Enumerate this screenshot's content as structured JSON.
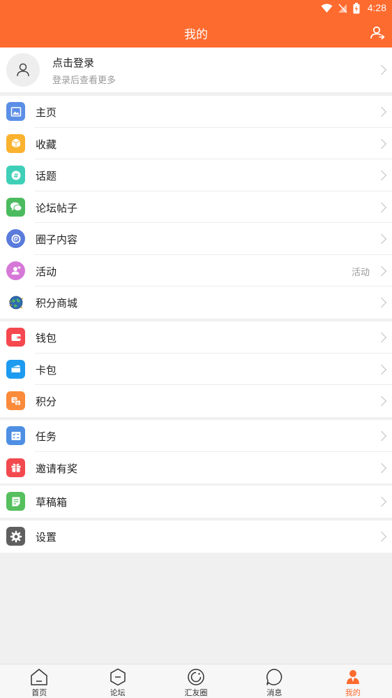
{
  "status_bar": {
    "time": "4:28"
  },
  "header": {
    "title": "我的"
  },
  "login": {
    "title": "点击登录",
    "subtitle": "登录后查看更多"
  },
  "groups": [
    [
      {
        "label": "主页",
        "icon": "image-icon",
        "color": "#5b8ee6"
      },
      {
        "label": "收藏",
        "icon": "box-icon",
        "color": "#fbb22f"
      },
      {
        "label": "话题",
        "icon": "hashtag-icon",
        "color": "#3fcfb8"
      },
      {
        "label": "论坛帖子",
        "icon": "chat-icon",
        "color": "#4cbb5f"
      },
      {
        "label": "圈子内容",
        "icon": "circle-icon",
        "color": "#5a7bdc"
      },
      {
        "label": "活动",
        "icon": "activity-icon",
        "color": "#d678d8",
        "value": "活动"
      },
      {
        "label": "积分商城",
        "icon": "globe-icon",
        "color": "#2e6bb0"
      }
    ],
    [
      {
        "label": "钱包",
        "icon": "wallet-icon",
        "color": "#f5484f"
      },
      {
        "label": "卡包",
        "icon": "card-icon",
        "color": "#1d9bf0"
      },
      {
        "label": "积分",
        "icon": "coins-icon",
        "color": "#fb8b3a"
      }
    ],
    [
      {
        "label": "任务",
        "icon": "task-icon",
        "color": "#4e8fe4"
      },
      {
        "label": "邀请有奖",
        "icon": "gift-icon",
        "color": "#f2494f"
      }
    ],
    [
      {
        "label": "草稿箱",
        "icon": "draft-icon",
        "color": "#56bf5e"
      }
    ],
    [
      {
        "label": "设置",
        "icon": "gear-icon",
        "color": "#5f5f5f"
      }
    ]
  ],
  "tabs": [
    {
      "label": "首页",
      "icon": "home-icon",
      "active": false
    },
    {
      "label": "论坛",
      "icon": "forum-icon",
      "active": false
    },
    {
      "label": "汇友圈",
      "icon": "moments-icon",
      "active": false
    },
    {
      "label": "消息",
      "icon": "message-icon",
      "active": false
    },
    {
      "label": "我的",
      "icon": "me-icon",
      "active": true
    }
  ],
  "colors": {
    "accent": "#fe6b2f",
    "background": "#f0f0f0"
  }
}
